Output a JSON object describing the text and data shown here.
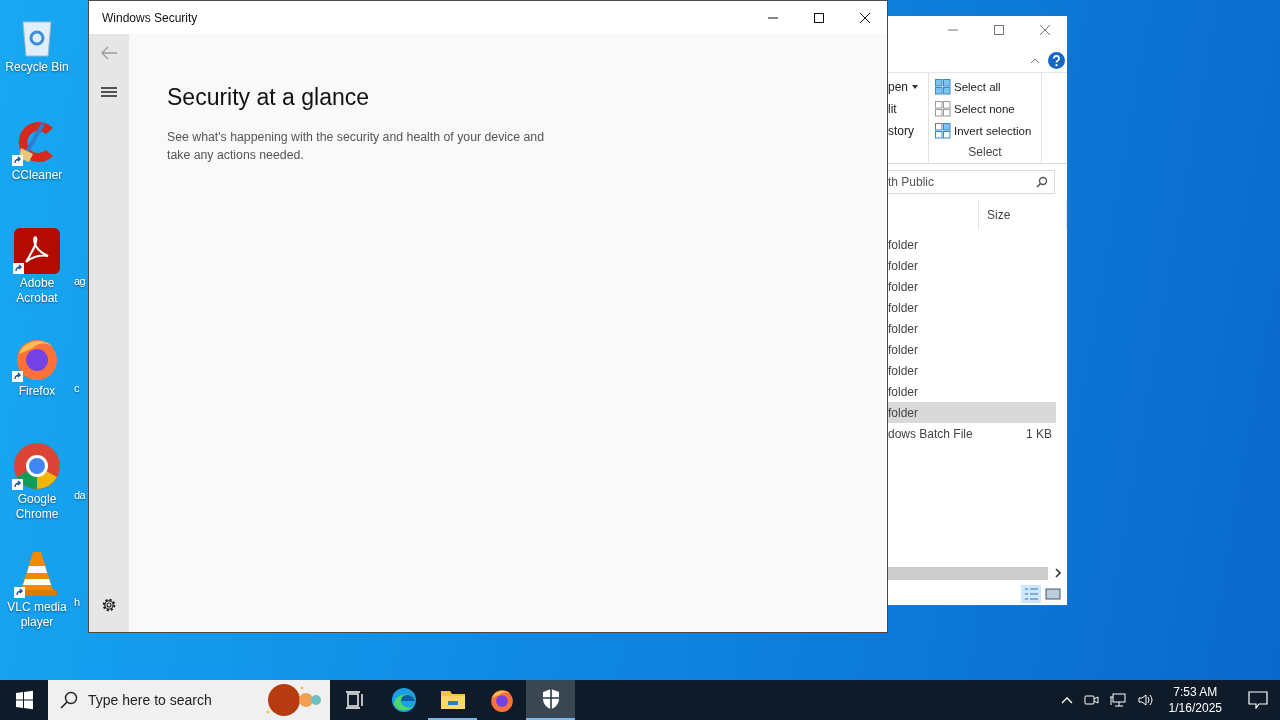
{
  "desktop": {
    "icons": [
      {
        "label": "Recycle Bin",
        "kind": "recycle",
        "shortcut": false
      },
      {
        "label": "CCleaner",
        "kind": "ccleaner",
        "shortcut": true
      },
      {
        "label": "Adobe Acrobat",
        "kind": "acrobat",
        "shortcut": true
      },
      {
        "label": "Firefox",
        "kind": "firefox",
        "shortcut": true
      },
      {
        "label": "Google Chrome",
        "kind": "chrome",
        "shortcut": true
      },
      {
        "label": "VLC media player",
        "kind": "vlc",
        "shortcut": true
      }
    ],
    "partial_labels": [
      "ag",
      "c",
      "da",
      "h"
    ]
  },
  "explorer": {
    "open_items": [
      {
        "label": "pen",
        "dropdown": true
      },
      {
        "label": "lit",
        "dropdown": false
      },
      {
        "label": "story",
        "dropdown": false
      }
    ],
    "select_group": {
      "label": "Select",
      "items": [
        {
          "label": "Select all",
          "kind": "all"
        },
        {
          "label": "Select none",
          "kind": "none"
        },
        {
          "label": "Invert selection",
          "kind": "invert"
        }
      ]
    },
    "search": {
      "value": "th Public"
    },
    "columns": [
      "Size"
    ],
    "rows": [
      {
        "type": "folder",
        "size": "",
        "selected": false
      },
      {
        "type": "folder",
        "size": "",
        "selected": false
      },
      {
        "type": "folder",
        "size": "",
        "selected": false
      },
      {
        "type": "folder",
        "size": "",
        "selected": false
      },
      {
        "type": "folder",
        "size": "",
        "selected": false
      },
      {
        "type": "folder",
        "size": "",
        "selected": false
      },
      {
        "type": "folder",
        "size": "",
        "selected": false
      },
      {
        "type": "folder",
        "size": "",
        "selected": false
      },
      {
        "type": "folder",
        "size": "",
        "selected": true
      },
      {
        "type": "dows Batch File",
        "size": "1 KB",
        "selected": false
      }
    ]
  },
  "security": {
    "title": "Windows Security",
    "heading": "Security at a glance",
    "description": "See what's happening with the security and health of your device and take any actions needed."
  },
  "taskbar": {
    "search": {
      "placeholder": "Type here to search"
    },
    "apps": [
      {
        "kind": "taskview",
        "running": false,
        "selected": false
      },
      {
        "kind": "edge",
        "running": false,
        "selected": false
      },
      {
        "kind": "explorer",
        "running": true,
        "selected": false
      },
      {
        "kind": "firefox",
        "running": false,
        "selected": false
      },
      {
        "kind": "security",
        "running": true,
        "selected": true
      }
    ],
    "time": "7:53 AM",
    "date": "1/16/2025"
  }
}
